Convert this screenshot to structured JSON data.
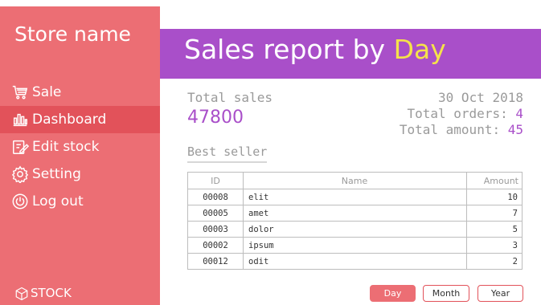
{
  "sidebar": {
    "store_name": "Store name",
    "items": [
      {
        "label": "Sale",
        "icon": "cart-icon",
        "active": false
      },
      {
        "label": "Dashboard",
        "icon": "bar-chart-icon",
        "active": true
      },
      {
        "label": "Edit stock",
        "icon": "edit-icon",
        "active": false
      },
      {
        "label": "Setting",
        "icon": "gear-icon",
        "active": false
      },
      {
        "label": "Log out",
        "icon": "power-icon",
        "active": false
      }
    ],
    "footer_logo": "STOCK"
  },
  "header": {
    "title_prefix": "Sales report by ",
    "title_highlight": "Day"
  },
  "summary": {
    "total_sales_label": "Total sales",
    "total_sales_value": "47800",
    "date": "30 Oct 2018",
    "total_orders_label": "Total orders:",
    "total_orders_value": "4",
    "total_amount_label": "Total amount:",
    "total_amount_value": "45"
  },
  "best_seller": {
    "title": "Best seller",
    "columns": [
      "ID",
      "Name",
      "Amount"
    ],
    "rows": [
      {
        "id": "00008",
        "name": "elit",
        "amount": "10"
      },
      {
        "id": "00005",
        "name": "amet",
        "amount": "7"
      },
      {
        "id": "00003",
        "name": "dolor",
        "amount": "5"
      },
      {
        "id": "00002",
        "name": "ipsum",
        "amount": "3"
      },
      {
        "id": "00012",
        "name": "odit",
        "amount": "2"
      }
    ]
  },
  "period_buttons": {
    "day": "Day",
    "month": "Month",
    "year": "Year",
    "selected": "Day"
  },
  "colors": {
    "sidebar": "#ec6e74",
    "active_item": "#e2525a",
    "header": "#a94fc9",
    "highlight": "#f5e24a",
    "value": "#a94fc9"
  }
}
